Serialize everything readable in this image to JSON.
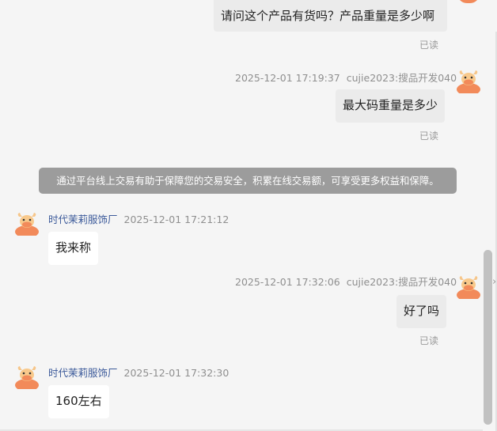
{
  "colors": {
    "background": "#f5f5f5",
    "outgoing_bubble": "#ebebeb",
    "incoming_bubble": "#ffffff",
    "notice_bg": "#9c9c9c",
    "sender_name": "#3c5a9a",
    "meta_text": "#8f8f8f",
    "avatar_accent": "#f28a5a"
  },
  "avatar_icon": "cartoon-cow-avatar-icon",
  "messages": [
    {
      "direction": "outgoing",
      "text": "请问这个产品有货吗？产品重量是多少啊",
      "read_status": "已读"
    },
    {
      "direction": "outgoing",
      "time": "2025-12-01 17:19:37",
      "sender": "cujie2023:搜品开发040",
      "text": "最大码重量是多少",
      "read_status": "已读"
    },
    {
      "direction": "incoming",
      "sender": "时代茉莉服饰厂",
      "time": "2025-12-01 17:21:12",
      "text": "我来称"
    },
    {
      "direction": "outgoing",
      "time": "2025-12-01 17:32:06",
      "sender": "cujie2023:搜品开发040",
      "text": "好了吗",
      "read_status": "已读"
    },
    {
      "direction": "incoming",
      "sender": "时代茉莉服饰厂",
      "time": "2025-12-01 17:32:30",
      "text": "160左右"
    }
  ],
  "system_notice": "通过平台线上交易有助于保障您的交易安全，积累在线交易额，可享受更多权益和保障。",
  "scrollbar": {
    "position_fraction": 1.0
  }
}
